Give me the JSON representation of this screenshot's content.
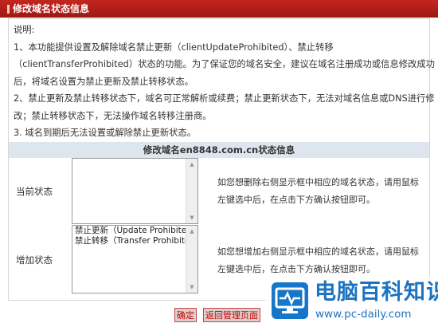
{
  "header": {
    "title": "修改域名状态信息"
  },
  "description": {
    "lines": [
      "说明:",
      "1、本功能提供设置及解除域名禁止更新（clientUpdateProhibited）、禁止转移",
      "（clientTransferProhibited）状态的功能。为了保证您的域名安全，建议在域名注册成功或信息修改成功",
      "后，将域名设置为禁止更新及禁止转移状态。",
      "2、禁止更新及禁止转移状态下，域名可正常解析或续费；禁止更新状态下，无法对域名信息或DNS进行修",
      "改；禁止转移状态下，无法操作域名转移注册商。",
      "3. 域名到期后无法设置或解除禁止更新状态。"
    ]
  },
  "domain_section": {
    "title": "修改域名en8848.com.cn状态信息"
  },
  "current_status": {
    "label": "当前状态",
    "options": [],
    "hint": "如您想删除右侧显示框中相应的域名状态，请用鼠标左键选中后，在点击下方确认按钮即可。"
  },
  "add_status": {
    "label": "增加状态",
    "options": [
      "禁止更新（Update Prohibited）",
      "禁止转移（Transfer Prohibited）"
    ],
    "hint": "如您想增加右侧显示框中相应的域名状态，请用鼠标左键选中后，在点击下方确认按钮即可。"
  },
  "buttons": {
    "confirm": "确定",
    "back": "返回管理页面"
  },
  "watermark": {
    "name": "电脑百科知识",
    "url": "www.pc-daily.com"
  }
}
